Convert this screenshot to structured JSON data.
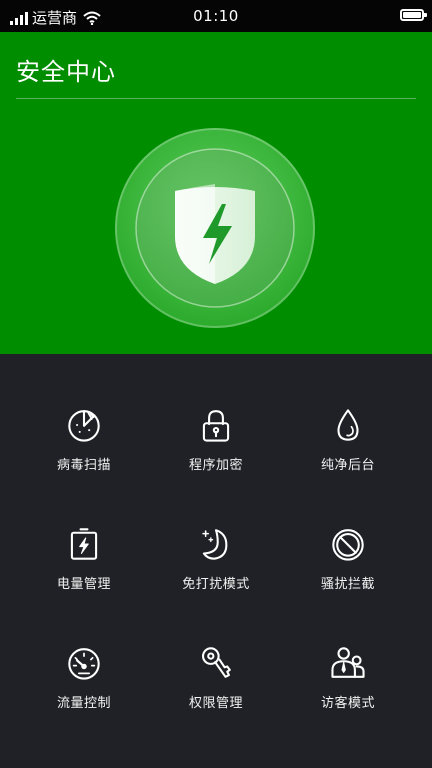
{
  "status_bar": {
    "carrier": "运营商",
    "time": "01:10"
  },
  "header": {
    "title": "安全中心"
  },
  "colors": {
    "header_bg": "#008d00",
    "grid_bg": "#1f2126",
    "status_bg": "#050505"
  },
  "features": [
    {
      "label": "病毒扫描",
      "icon": "scan-dial-icon"
    },
    {
      "label": "程序加密",
      "icon": "lock-icon"
    },
    {
      "label": "纯净后台",
      "icon": "water-drop-icon"
    },
    {
      "label": "电量管理",
      "icon": "battery-bolt-icon"
    },
    {
      "label": "免打扰模式",
      "icon": "moon-stars-icon"
    },
    {
      "label": "骚扰拦截",
      "icon": "block-circle-icon"
    },
    {
      "label": "流量控制",
      "icon": "speedometer-icon"
    },
    {
      "label": "权限管理",
      "icon": "key-icon"
    },
    {
      "label": "访客模式",
      "icon": "visitor-icon"
    }
  ]
}
